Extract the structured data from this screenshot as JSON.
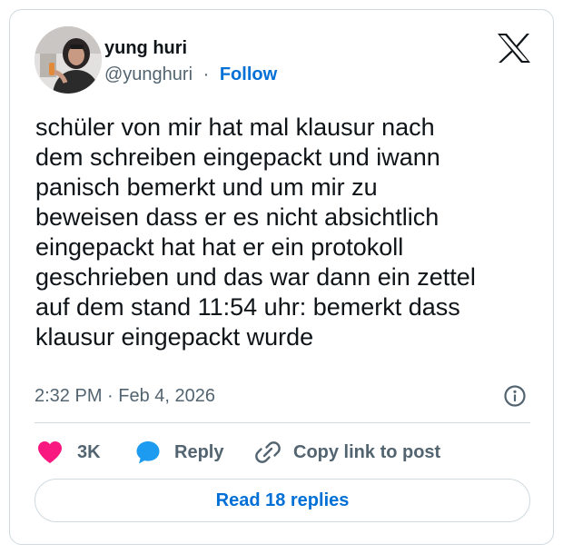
{
  "author": {
    "name": "yung huri",
    "handle": "@yunghuri",
    "separator": "·",
    "follow_label": "Follow",
    "avatar_icon": "profile-photo"
  },
  "brand": {
    "icon": "x-logo-icon",
    "color": "#0f1419"
  },
  "tweet": {
    "lines": [
      "schüler von mir hat mal klausur nach",
      "dem schreiben eingepackt und iwann",
      "panisch bemerkt und um mir zu",
      "beweisen dass er es nicht absichtlich",
      "eingepackt hat hat er ein protokoll",
      "geschrieben und das war dann ein zettel",
      "auf dem stand 11:54 uhr: bemerkt dass",
      "klausur eingepackt wurde"
    ],
    "timestamp": "2:32 PM · Feb 4, 2026"
  },
  "actions": {
    "likes_count": "3K",
    "reply_label": "Reply",
    "copy_link_label": "Copy link to post"
  },
  "footer": {
    "read_replies_label": "Read 18 replies"
  },
  "colors": {
    "like": "#f91880",
    "reply": "#1d9bf0",
    "link": "#006fd6",
    "muted": "#536471",
    "border": "#cfd9de"
  }
}
